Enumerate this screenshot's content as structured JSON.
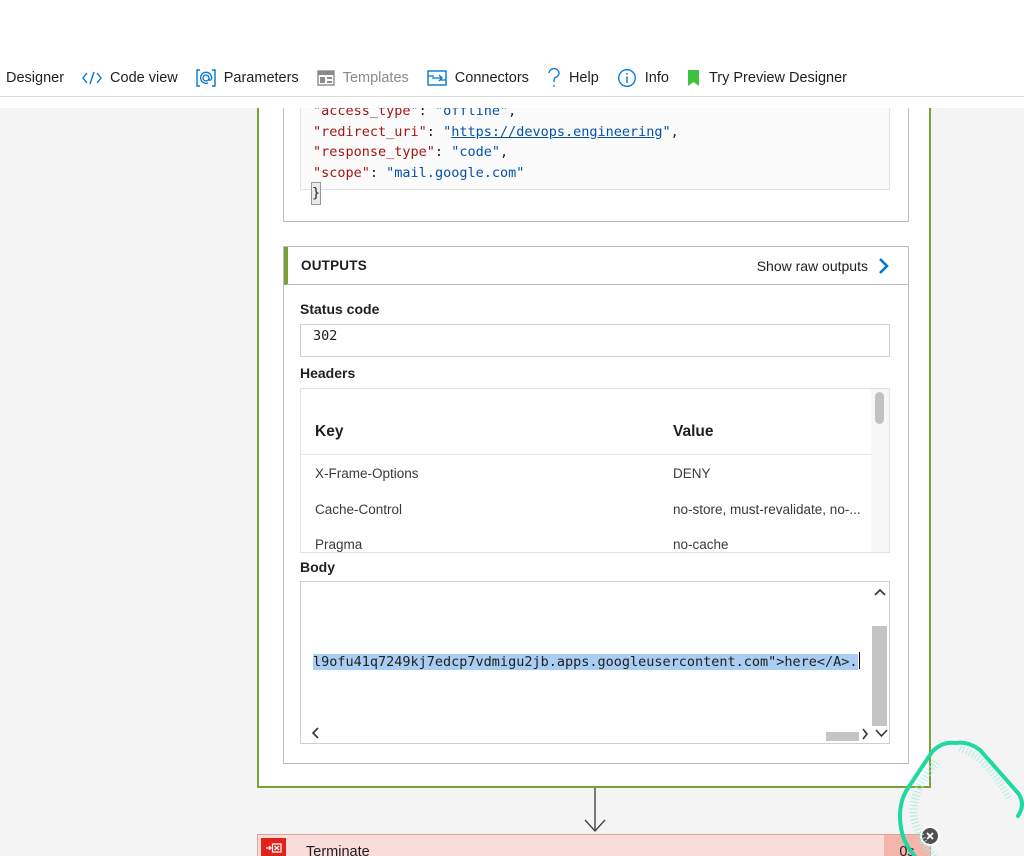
{
  "toolbar": {
    "items": [
      {
        "label": "Designer",
        "icon": "designer-icon",
        "disabled": false
      },
      {
        "label": "Code view",
        "icon": "code-view-icon",
        "disabled": false
      },
      {
        "label": "Parameters",
        "icon": "parameters-icon",
        "disabled": false
      },
      {
        "label": "Templates",
        "icon": "templates-icon",
        "disabled": true
      },
      {
        "label": "Connectors",
        "icon": "connectors-icon",
        "disabled": false
      },
      {
        "label": "Help",
        "icon": "help-icon",
        "disabled": false
      },
      {
        "label": "Info",
        "icon": "info-icon",
        "disabled": false
      },
      {
        "label": "Try Preview Designer",
        "icon": "bookmark-icon",
        "disabled": false
      }
    ]
  },
  "inputs": {
    "code_lines": [
      {
        "key": "\"access_type\"",
        "value": "\"offline\"",
        "value_is_link": false,
        "suffix": ","
      },
      {
        "key": "\"redirect_uri\"",
        "value_prefix": "\"",
        "value": "https://devops.engineering",
        "value_suffix": "\"",
        "value_is_link": true,
        "suffix": ","
      },
      {
        "key": "\"response_type\"",
        "value": "\"code\"",
        "value_is_link": false,
        "suffix": ","
      },
      {
        "key": "\"scope\"",
        "value": "\"mail.google.com\"",
        "value_is_link": false,
        "suffix": ""
      }
    ],
    "closing_brace": "}"
  },
  "outputs": {
    "title": "OUTPUTS",
    "show_raw_label": "Show raw outputs",
    "status_code_label": "Status code",
    "status_code_value": "302",
    "headers_label": "Headers",
    "headers_table": {
      "key_header": "Key",
      "value_header": "Value",
      "rows": [
        {
          "key": "X-Frame-Options",
          "value": "DENY"
        },
        {
          "key": "Cache-Control",
          "value": "no-store, must-revalidate, no-..."
        },
        {
          "key": "Pragma",
          "value": "no-cache"
        }
      ]
    },
    "body_label": "Body",
    "body_text_selected": "l9ofu41q7249kj7edcp7vdmigu2jb.apps.googleusercontent.com",
    "body_text_rest": "\">here</A>."
  },
  "terminate": {
    "label": "Terminate",
    "duration": "0s"
  },
  "colors": {
    "accent_blue": "#0078d4",
    "success_green": "#7ba035",
    "terminate_red": "#e0231b",
    "terminate_bg": "#fadcd8",
    "spinner_green": "#1ed9a0"
  }
}
